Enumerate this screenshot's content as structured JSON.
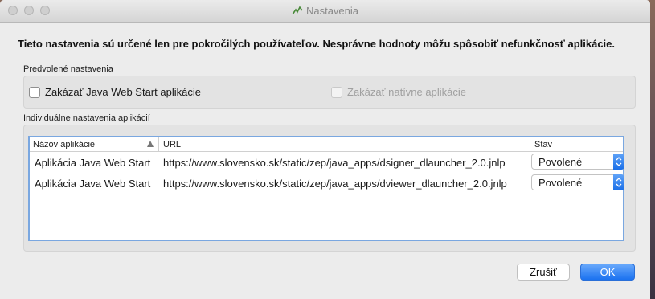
{
  "window": {
    "title": "Nastavenia"
  },
  "notice": "Tieto nastavenia sú určené len pre pokročilých používateľov. Nesprávne hodnoty môžu spôsobiť nefunkčnosť aplikácie.",
  "defaults": {
    "label": "Predvolené nastavenia",
    "disable_jws": "Zakázať Java Web Start aplikácie",
    "disable_native": "Zakázať natívne aplikácie"
  },
  "individual": {
    "label": "Individuálne nastavenia aplikácií",
    "columns": {
      "name": "Názov aplikácie",
      "url": "URL",
      "status": "Stav"
    },
    "rows": [
      {
        "name": "Aplikácia Java Web Start",
        "url": "https://www.slovensko.sk/static/zep/java_apps/dsigner_dlauncher_2.0.jnlp",
        "status": "Povolené"
      },
      {
        "name": "Aplikácia Java Web Start",
        "url": "https://www.slovensko.sk/static/zep/java_apps/dviewer_dlauncher_2.0.jnlp",
        "status": "Povolené"
      }
    ]
  },
  "buttons": {
    "cancel": "Zrušiť",
    "ok": "OK"
  },
  "colors": {
    "accent": "#1b72f0",
    "selection_border": "#7aa7e0"
  }
}
